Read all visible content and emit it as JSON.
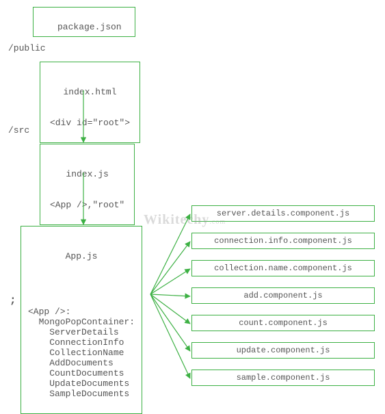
{
  "boxes": {
    "package": "package.json",
    "dir_public": "/public",
    "index_html_l1": "index.html",
    "index_html_l2": "<div id=\"root\">",
    "dir_src": "/src",
    "index_js_l1": "index.js",
    "index_js_l2": "<App />,\"root\"",
    "app_js_title": "App.js",
    "app_js_body": "<App />:\n  MongoPopContainer:\n    ServerDetails\n    ConnectionInfo\n    CollectionName\n    AddDocuments\n    CountDocuments\n    UpdateDocuments\n    SampleDocuments"
  },
  "components": [
    "server.details.component.js",
    "connection.info.component.js",
    "collection.name.component.js",
    "add.component.js",
    "count.component.js",
    "update.component.js",
    "sample.component.js"
  ],
  "watermark": {
    "main": "Wikitechy",
    "sub": ".com"
  },
  "semicolon": ";"
}
